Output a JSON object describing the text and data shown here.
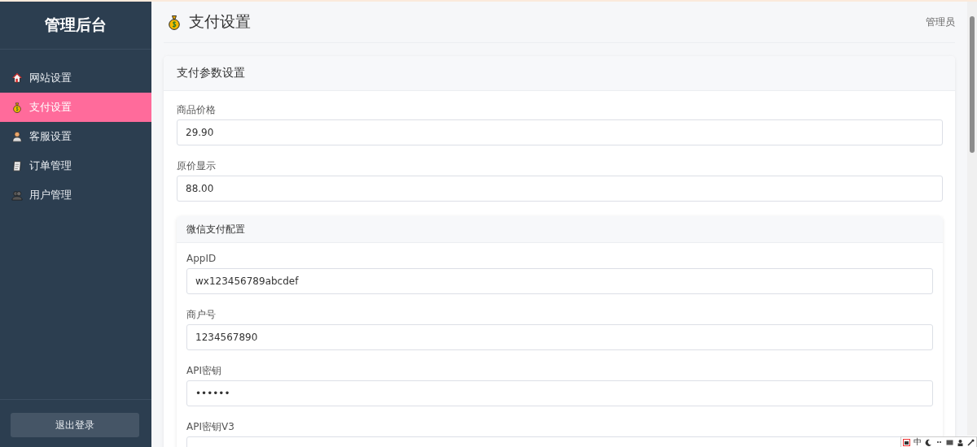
{
  "sidebar": {
    "title": "管理后台",
    "items": [
      {
        "label": "网站设置",
        "selected": false
      },
      {
        "label": "支付设置",
        "selected": true
      },
      {
        "label": "客服设置",
        "selected": false
      },
      {
        "label": "订单管理",
        "selected": false
      },
      {
        "label": "用户管理",
        "selected": false
      }
    ],
    "logout_button": "退出登录"
  },
  "header": {
    "title": "支付设置",
    "user": "管理员"
  },
  "card": {
    "title": "支付参数设置",
    "fields": [
      {
        "label": "商品价格",
        "value": "29.90"
      },
      {
        "label": "原价显示",
        "value": "88.00"
      }
    ],
    "subcard": {
      "title": "微信支付配置",
      "fields": [
        {
          "label": "AppID",
          "value": "wx123456789abcdef"
        },
        {
          "label": "商户号",
          "value": "1234567890"
        },
        {
          "label": "API密钥",
          "value": "••••••"
        },
        {
          "label": "API密钥V3"
        }
      ]
    }
  },
  "ime_toolbar": {
    "mode": "中"
  }
}
